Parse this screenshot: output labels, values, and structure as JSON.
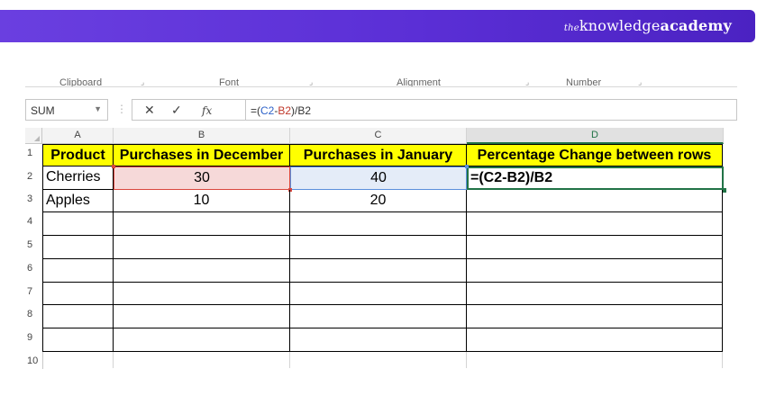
{
  "brand": {
    "prefix": "the",
    "word1": "knowledge",
    "word2": "academy"
  },
  "ribbon_groups": [
    "Clipboard",
    "Font",
    "Alignment",
    "Number"
  ],
  "formula_bar": {
    "name_box": "SUM",
    "cancel_symbol": "✕",
    "enter_symbol": "✓",
    "fx_label": "fx",
    "formula_parts": {
      "prefix": "=(",
      "c2": "C2",
      "dash": "-",
      "b2": "B2",
      "suffix": ")/B2"
    }
  },
  "columns": [
    "A",
    "B",
    "C",
    "D"
  ],
  "selected_column": "D",
  "rows": [
    "1",
    "2",
    "3",
    "4",
    "5",
    "6",
    "7",
    "8",
    "9",
    "10"
  ],
  "table": {
    "headers": [
      "Product",
      "Purchases in December",
      "Purchases in January",
      "Percentage Change between rows"
    ],
    "rows": [
      [
        "Cherries",
        "30",
        "40",
        "=(C2-B2)/B2"
      ],
      [
        "Apples",
        "10",
        "20",
        ""
      ]
    ]
  },
  "colors": {
    "banner": "#5b2fd6",
    "header_fill": "#ffff00",
    "b2_highlight": "#f6d9d9",
    "c2_highlight": "#e4ecf8",
    "active_cell": "#217346"
  }
}
